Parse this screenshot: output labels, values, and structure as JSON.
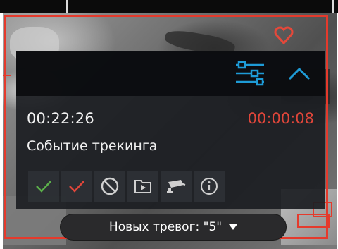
{
  "event": {
    "time": "00:22:26",
    "elapsed": "00:00:08",
    "title": "Событие трекинга"
  },
  "actions": [
    {
      "name": "confirm-icon",
      "color": "#5bb04a"
    },
    {
      "name": "confirm-red-icon",
      "color": "#e0463a"
    },
    {
      "name": "ignore-icon",
      "color": "#d0d0d0"
    },
    {
      "name": "archive-icon",
      "color": "#d0d0d0"
    },
    {
      "name": "camera-icon",
      "color": "#d0d0d0"
    },
    {
      "name": "info-icon",
      "color": "#d0d0d0"
    }
  ],
  "alarms": {
    "label": "Новых тревог: \"5\""
  },
  "colors": {
    "accent": "#1e9bd7",
    "alarm_red": "#e53a2c",
    "panel_bg": "#1c1e22"
  }
}
